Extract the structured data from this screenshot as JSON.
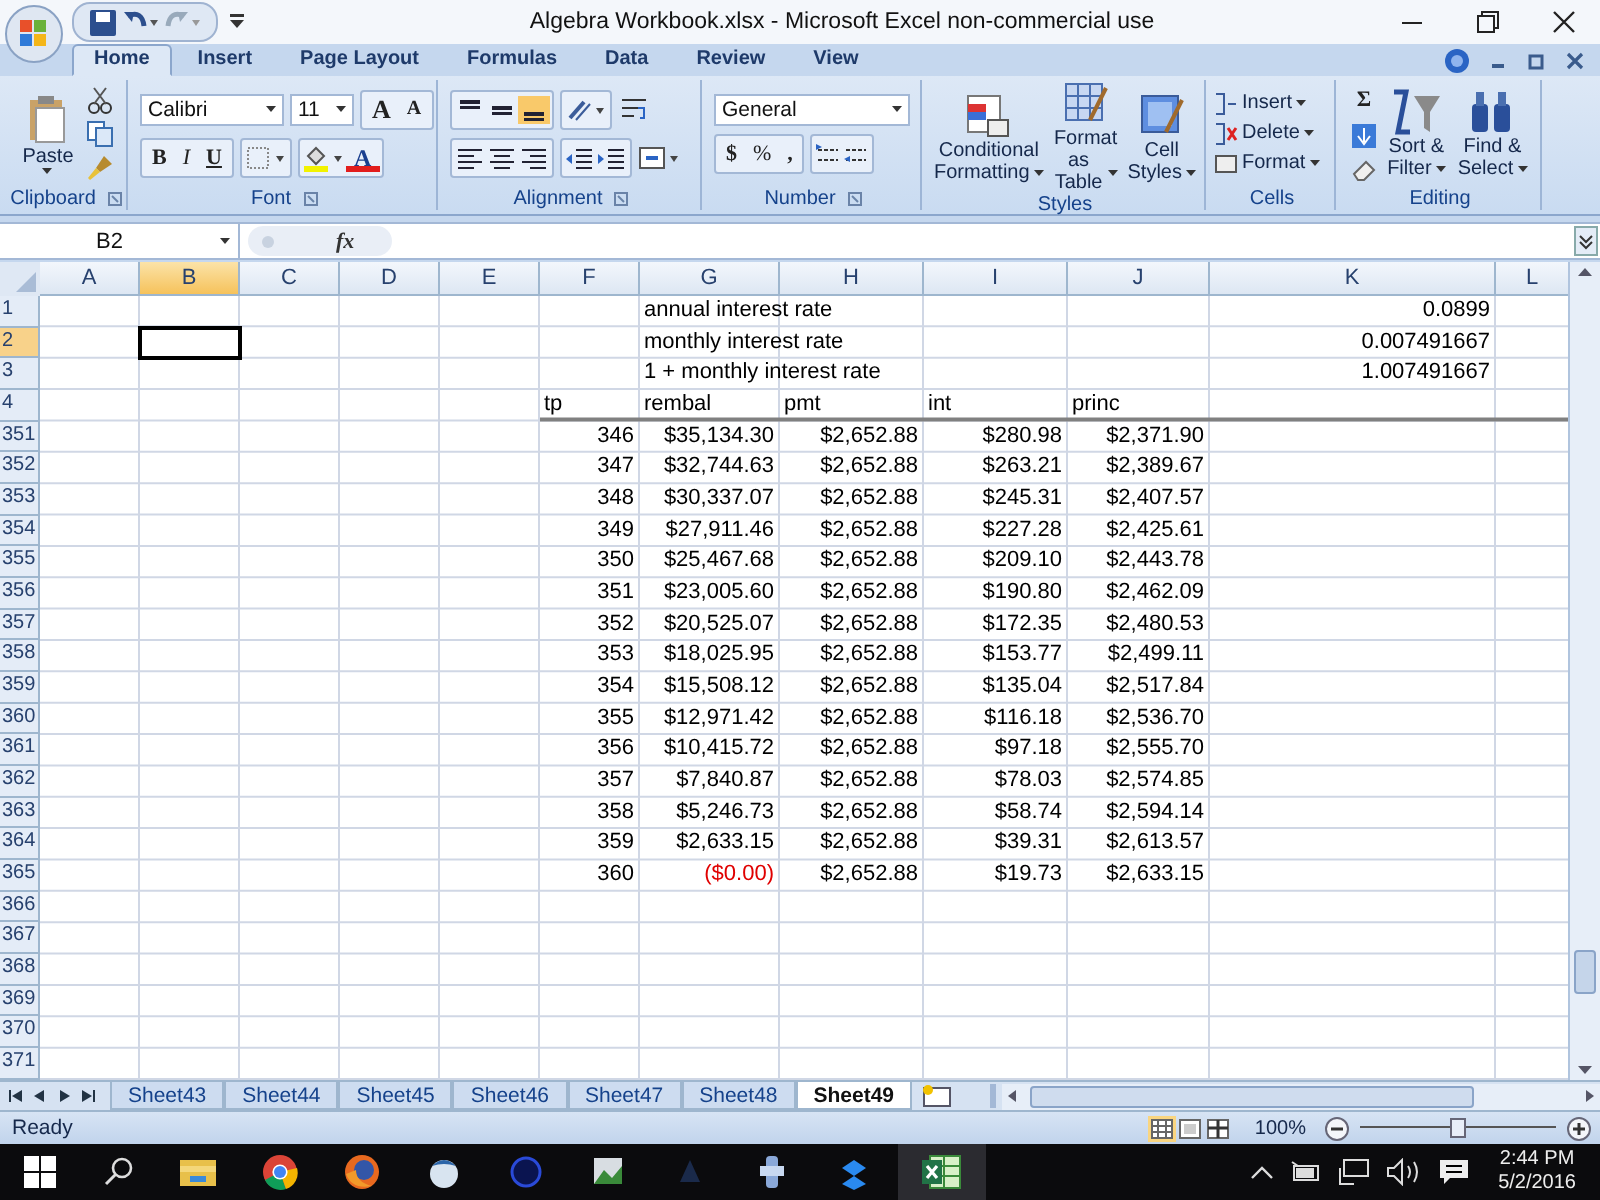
{
  "window": {
    "title": "Algebra Workbook.xlsx - Microsoft Excel non-commercial use"
  },
  "ribbon_tabs": [
    {
      "label": "Home",
      "selected": true
    },
    {
      "label": "Insert",
      "selected": false
    },
    {
      "label": "Page Layout",
      "selected": false
    },
    {
      "label": "Formulas",
      "selected": false
    },
    {
      "label": "Data",
      "selected": false
    },
    {
      "label": "Review",
      "selected": false
    },
    {
      "label": "View",
      "selected": false
    }
  ],
  "clipboard": {
    "label": "Clipboard",
    "paste": "Paste"
  },
  "font": {
    "label": "Font",
    "name": "Calibri",
    "size": "11",
    "grow": "A",
    "shrink": "A",
    "bold": "B",
    "italic": "I",
    "underline": "U",
    "font_color_glyph": "A"
  },
  "alignment": {
    "label": "Alignment",
    "vertical": [
      {
        "kind": "top",
        "selected": false
      },
      {
        "kind": "middle",
        "selected": false
      },
      {
        "kind": "bottom",
        "selected": true
      }
    ]
  },
  "number": {
    "label": "Number",
    "format": "General",
    "currency": "$",
    "percent": "%",
    "comma": ","
  },
  "styles": {
    "label": "Styles",
    "buttons": [
      {
        "kind": "conditional",
        "lines": [
          "Conditional",
          "Formatting"
        ]
      },
      {
        "kind": "table",
        "lines": [
          "Format",
          "as Table"
        ]
      },
      {
        "kind": "cell",
        "lines": [
          "Cell",
          "Styles"
        ]
      }
    ]
  },
  "cells": {
    "label": "Cells",
    "buttons": [
      {
        "kind": "insert",
        "label": "Insert"
      },
      {
        "kind": "delete",
        "label": "Delete"
      },
      {
        "kind": "format",
        "label": "Format"
      }
    ]
  },
  "editing": {
    "label": "Editing",
    "sigma": "Σ",
    "buttons": [
      {
        "kind": "sort",
        "lines": [
          "Sort &",
          "Filter"
        ]
      },
      {
        "kind": "find",
        "lines": [
          "Find &",
          "Select"
        ]
      }
    ]
  },
  "formula_bar": {
    "name_box": "B2",
    "fx": "fx"
  },
  "columns": [
    {
      "label": "A",
      "selected": false
    },
    {
      "label": "B",
      "selected": true
    },
    {
      "label": "C",
      "selected": false
    },
    {
      "label": "D",
      "selected": false
    },
    {
      "label": "E",
      "selected": false
    },
    {
      "label": "F",
      "selected": false
    },
    {
      "label": "G",
      "selected": false
    },
    {
      "label": "H",
      "selected": false
    },
    {
      "label": "I",
      "selected": false
    },
    {
      "label": "J",
      "selected": false
    },
    {
      "label": "K",
      "selected": false
    },
    {
      "label": "L",
      "selected": false
    }
  ],
  "rows": [
    {
      "number": "1",
      "selected": false,
      "kind": "label",
      "cells": {
        "G": "annual interest rate",
        "K": "0.0899"
      }
    },
    {
      "number": "2",
      "selected": true,
      "kind": "label",
      "cells": {
        "G": "monthly interest rate",
        "K": "0.007491667"
      }
    },
    {
      "number": "3",
      "selected": false,
      "kind": "label",
      "cells": {
        "G": "1 + monthly interest rate",
        "K": "1.007491667"
      }
    },
    {
      "number": "4",
      "selected": false,
      "kind": "header",
      "cells": {
        "F": "tp",
        "G": "rembal",
        "H": "pmt",
        "I": "int",
        "J": "princ"
      }
    },
    {
      "number": "351",
      "selected": false,
      "kind": "data",
      "cells": {
        "F": "346",
        "G": "$35,134.30",
        "H": "$2,652.88",
        "I": "$280.98",
        "J": "$2,371.90"
      }
    },
    {
      "number": "352",
      "selected": false,
      "kind": "data",
      "cells": {
        "F": "347",
        "G": "$32,744.63",
        "H": "$2,652.88",
        "I": "$263.21",
        "J": "$2,389.67"
      }
    },
    {
      "number": "353",
      "selected": false,
      "kind": "data",
      "cells": {
        "F": "348",
        "G": "$30,337.07",
        "H": "$2,652.88",
        "I": "$245.31",
        "J": "$2,407.57"
      }
    },
    {
      "number": "354",
      "selected": false,
      "kind": "data",
      "cells": {
        "F": "349",
        "G": "$27,911.46",
        "H": "$2,652.88",
        "I": "$227.28",
        "J": "$2,425.61"
      }
    },
    {
      "number": "355",
      "selected": false,
      "kind": "data",
      "cells": {
        "F": "350",
        "G": "$25,467.68",
        "H": "$2,652.88",
        "I": "$209.10",
        "J": "$2,443.78"
      }
    },
    {
      "number": "356",
      "selected": false,
      "kind": "data",
      "cells": {
        "F": "351",
        "G": "$23,005.60",
        "H": "$2,652.88",
        "I": "$190.80",
        "J": "$2,462.09"
      }
    },
    {
      "number": "357",
      "selected": false,
      "kind": "data",
      "cells": {
        "F": "352",
        "G": "$20,525.07",
        "H": "$2,652.88",
        "I": "$172.35",
        "J": "$2,480.53"
      }
    },
    {
      "number": "358",
      "selected": false,
      "kind": "data",
      "cells": {
        "F": "353",
        "G": "$18,025.95",
        "H": "$2,652.88",
        "I": "$153.77",
        "J": "$2,499.11"
      }
    },
    {
      "number": "359",
      "selected": false,
      "kind": "data",
      "cells": {
        "F": "354",
        "G": "$15,508.12",
        "H": "$2,652.88",
        "I": "$135.04",
        "J": "$2,517.84"
      }
    },
    {
      "number": "360",
      "selected": false,
      "kind": "data",
      "cells": {
        "F": "355",
        "G": "$12,971.42",
        "H": "$2,652.88",
        "I": "$116.18",
        "J": "$2,536.70"
      }
    },
    {
      "number": "361",
      "selected": false,
      "kind": "data",
      "cells": {
        "F": "356",
        "G": "$10,415.72",
        "H": "$2,652.88",
        "I": "$97.18",
        "J": "$2,555.70"
      }
    },
    {
      "number": "362",
      "selected": false,
      "kind": "data",
      "cells": {
        "F": "357",
        "G": "$7,840.87",
        "H": "$2,652.88",
        "I": "$78.03",
        "J": "$2,574.85"
      }
    },
    {
      "number": "363",
      "selected": false,
      "kind": "data",
      "cells": {
        "F": "358",
        "G": "$5,246.73",
        "H": "$2,652.88",
        "I": "$58.74",
        "J": "$2,594.14"
      }
    },
    {
      "number": "364",
      "selected": false,
      "kind": "data",
      "cells": {
        "F": "359",
        "G": "$2,633.15",
        "H": "$2,652.88",
        "I": "$39.31",
        "J": "$2,613.57"
      }
    },
    {
      "number": "365",
      "selected": false,
      "kind": "data",
      "cells": {
        "F": "360",
        "G": {
          "text": "($0.00)",
          "negative": true
        },
        "H": "$2,652.88",
        "I": "$19.73",
        "J": "$2,633.15"
      }
    },
    {
      "number": "366",
      "selected": false,
      "kind": "empty"
    },
    {
      "number": "367",
      "selected": false,
      "kind": "empty"
    },
    {
      "number": "368",
      "selected": false,
      "kind": "empty"
    },
    {
      "number": "369",
      "selected": false,
      "kind": "empty"
    },
    {
      "number": "370",
      "selected": false,
      "kind": "empty"
    },
    {
      "number": "371",
      "selected": false,
      "kind": "empty"
    }
  ],
  "sheet_tabs": [
    {
      "label": "Sheet43",
      "selected": false
    },
    {
      "label": "Sheet44",
      "selected": false
    },
    {
      "label": "Sheet45",
      "selected": false
    },
    {
      "label": "Sheet46",
      "selected": false
    },
    {
      "label": "Sheet47",
      "selected": false
    },
    {
      "label": "Sheet48",
      "selected": false
    },
    {
      "label": "Sheet49",
      "selected": true
    }
  ],
  "status_bar": {
    "status": "Ready",
    "zoom": "100%",
    "zoom_slider": {
      "level": 0.5
    },
    "views": [
      {
        "kind": "normal",
        "selected": true
      },
      {
        "kind": "layout",
        "selected": false
      },
      {
        "kind": "break",
        "selected": false
      }
    ]
  },
  "taskbar": {
    "time": "2:44 PM",
    "date": "5/2/2016"
  }
}
